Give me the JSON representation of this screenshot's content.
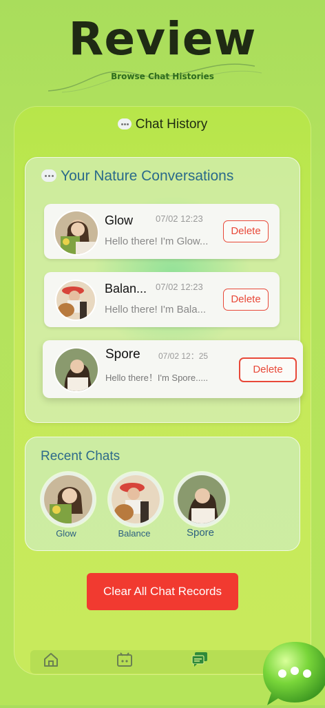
{
  "header": {
    "title": "Review",
    "subtitle": "Browse Chat Histories"
  },
  "panel": {
    "title": "Chat History"
  },
  "conversations": {
    "title": "Your Nature Conversations",
    "items": [
      {
        "name": "Glow",
        "time": "07/02 12:23",
        "message": "Hello there! I'm Glow...",
        "delete_label": "Delete"
      },
      {
        "name": "Balan...",
        "time": "07/02 12:23",
        "message": "Hello there! I'm Bala...",
        "delete_label": "Delete"
      },
      {
        "name": "Spore",
        "time": "07/02 12：25",
        "message": "Hello there！I'm Spore.....",
        "delete_label": "Delete"
      }
    ]
  },
  "recent": {
    "title": "Recent Chats",
    "items": [
      {
        "name": "Glow"
      },
      {
        "name": "Balance"
      },
      {
        "name": "Spore"
      }
    ]
  },
  "clear_button": {
    "label": "Clear All Chat Records"
  },
  "tabs": [
    {
      "icon": "home-icon"
    },
    {
      "icon": "calendar-icon"
    },
    {
      "icon": "chat-history-icon",
      "active": true
    }
  ],
  "colors": {
    "accent": "#f13a30",
    "title_blue": "#2a6a8a",
    "background": "#b4e35e"
  }
}
